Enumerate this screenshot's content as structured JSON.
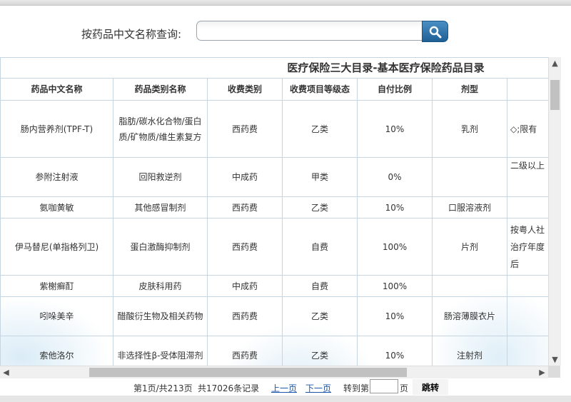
{
  "search": {
    "label": "按药品中文名称查询:",
    "value": "",
    "icon": "search-icon"
  },
  "table": {
    "title": "医疗保险三大目录-基本医疗保险药品目录",
    "columns": [
      "药品中文名称",
      "药品类别名称",
      "收费类别",
      "收费项目等级态",
      "自付比例",
      "剂型",
      ""
    ],
    "rows": [
      {
        "name": "肠内营养剂(TPF-T)",
        "category": "脂肪/碳水化合物/蛋白质/矿物质/维生素复方",
        "fee_type": "西药费",
        "grade": "乙类",
        "ratio": "10%",
        "form": "乳剂",
        "note": "◇;限有"
      },
      {
        "name": "参附注射液",
        "category": "回阳救逆剂",
        "fee_type": "中成药",
        "grade": "甲类",
        "ratio": "0%",
        "form": "",
        "note": "二级以上"
      },
      {
        "name": "氨咖黄敏",
        "category": "其他感冒制剂",
        "fee_type": "西药费",
        "grade": "乙类",
        "ratio": "10%",
        "form": "口服溶液剂",
        "note": ""
      },
      {
        "name": "伊马替尼(单指格列卫)",
        "category": "蛋白激酶抑制剂",
        "fee_type": "西药费",
        "grade": "自费",
        "ratio": "100%",
        "form": "片剂",
        "note": "按粤人社\n治疗年度\n后"
      },
      {
        "name": "紫榭癣酊",
        "category": "皮肤科用药",
        "fee_type": "中成药",
        "grade": "自费",
        "ratio": "100%",
        "form": "",
        "note": ""
      },
      {
        "name": "吲哚美辛",
        "category": "醋酸衍生物及相关药物",
        "fee_type": "西药费",
        "grade": "乙类",
        "ratio": "10%",
        "form": "肠溶薄膜衣片",
        "note": ""
      },
      {
        "name": "索他洛尔",
        "category": "非选择性β-受体阻滞剂",
        "fee_type": "西药费",
        "grade": "乙类",
        "ratio": "10%",
        "form": "注射剂",
        "note": ""
      }
    ]
  },
  "pager": {
    "page_info": "第1页/共213页",
    "record_info": "共17026条记录",
    "prev": "上一页",
    "next": "下一页",
    "goto_prefix": "转到第",
    "goto_suffix": "页",
    "goto_value": "",
    "goto_button": "跳转"
  }
}
